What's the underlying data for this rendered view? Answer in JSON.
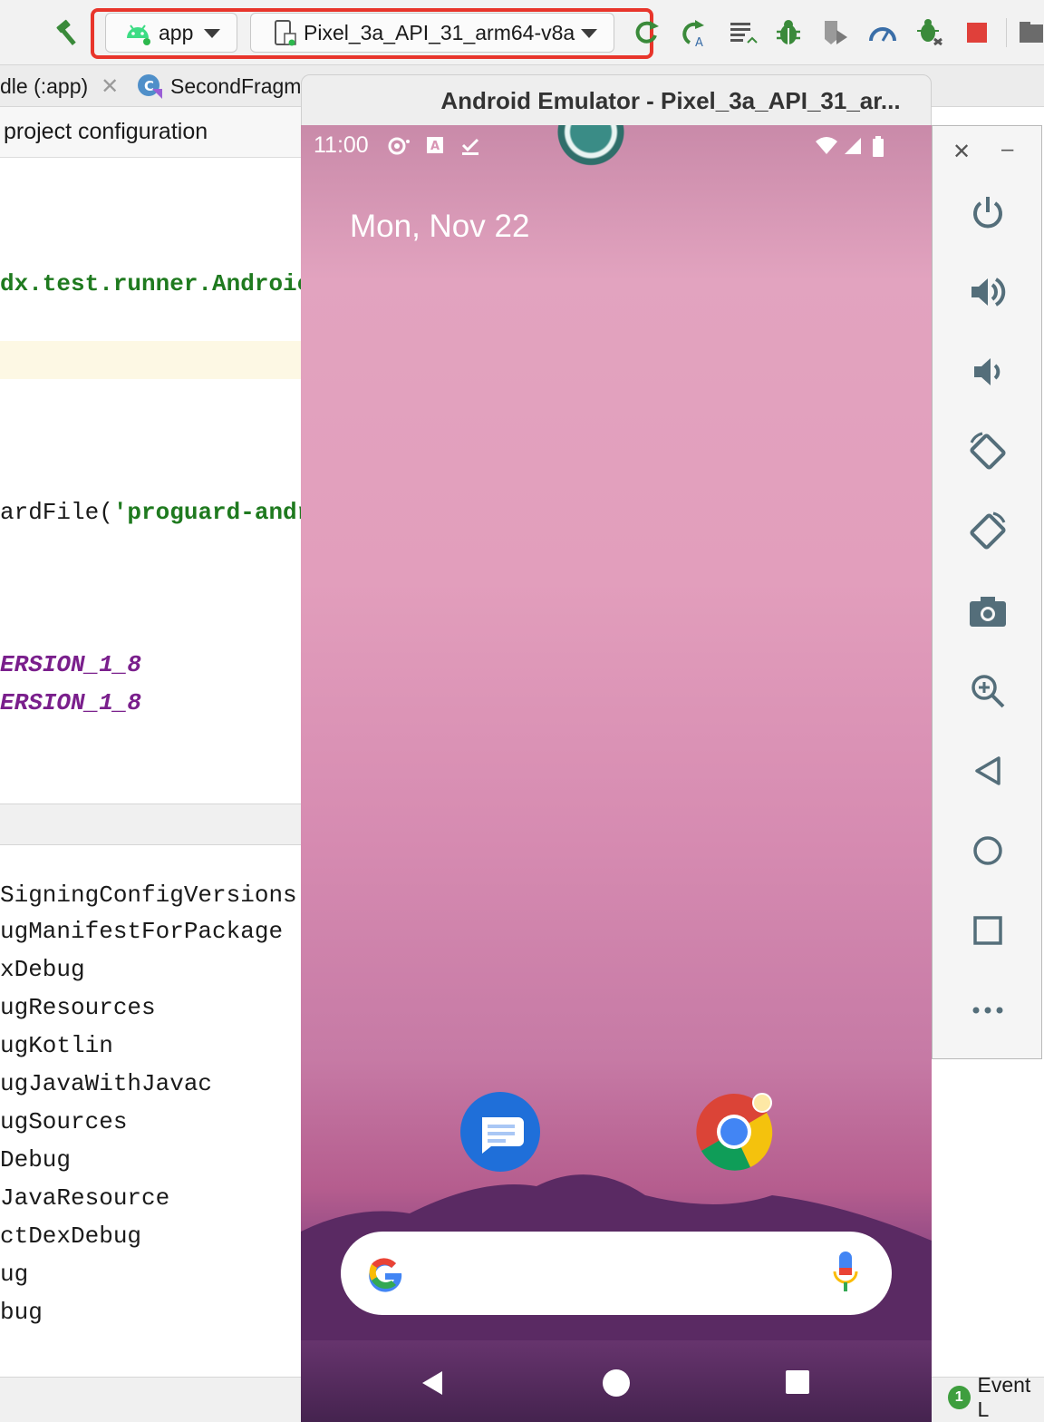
{
  "toolbar": {
    "module_label": "app",
    "device_label": "Pixel_3a_API_31_arm64-v8a"
  },
  "tabs": [
    {
      "label": "dle (:app)"
    },
    {
      "label": "SecondFragm"
    }
  ],
  "banner": {
    "text": "project configuration"
  },
  "editor": {
    "lines": [
      {
        "text": "dx.test.runner.Androic"
      },
      {
        "prefix": "ardFile(",
        "str": "'proguard-andr"
      },
      {
        "text": "ERSION_1_8"
      },
      {
        "text": "ERSION_1_8"
      }
    ]
  },
  "output": {
    "lines": [
      "SigningConfigVersions",
      "ugManifestForPackage",
      "xDebug",
      "ugResources",
      "ugKotlin",
      "ugJavaWithJavac",
      "ugSources",
      "Debug",
      "JavaResource",
      "ctDexDebug",
      "ug",
      "bug"
    ]
  },
  "emulator": {
    "title": "Android Emulator - Pixel_3a_API_31_ar...",
    "time": "11:00",
    "date": "Mon, Nov 22"
  },
  "statusbar": {
    "event_count": "1",
    "event_label": "Event L"
  },
  "colors": {
    "highlight": "#e8352b",
    "android_green": "#3ddc84",
    "code_green": "#1f7a1f",
    "code_purple": "#7a1f8c"
  }
}
